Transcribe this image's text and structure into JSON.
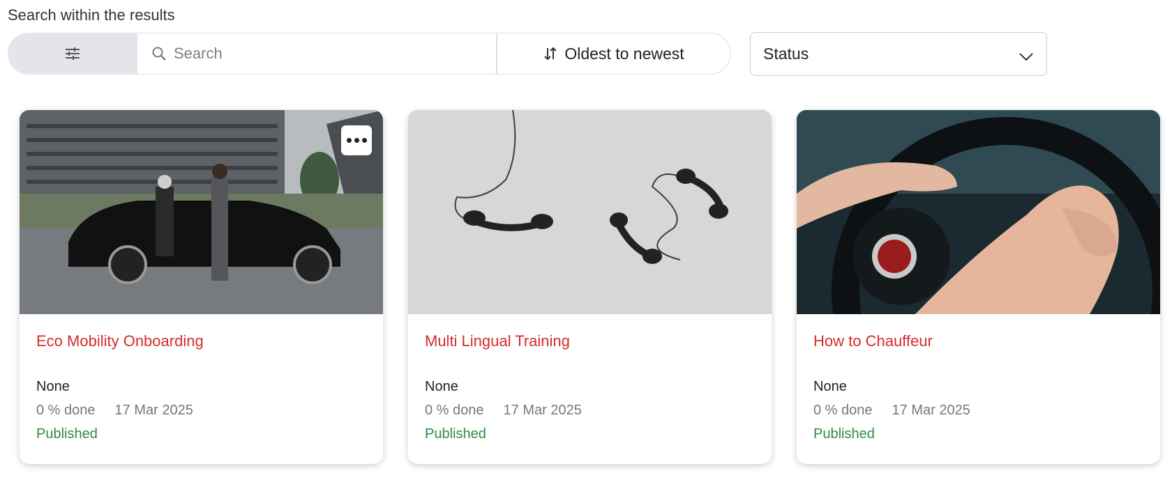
{
  "search_section": {
    "heading": "Search within the results",
    "search_placeholder": "Search",
    "sort_label": "Oldest to newest",
    "status_label": "Status"
  },
  "courses": [
    {
      "title": "Eco Mobility Onboarding",
      "owner": "None",
      "progress": "0 % done",
      "date": "17 Mar 2025",
      "status": "Published",
      "image": "chauffeur-car-photo"
    },
    {
      "title": "Multi Lingual Training",
      "owner": "None",
      "progress": "0 % done",
      "date": "17 Mar 2025",
      "status": "Published",
      "image": "telephone-handsets-photo"
    },
    {
      "title": "How to Chauffeur",
      "owner": "None",
      "progress": "0 % done",
      "date": "17 Mar 2025",
      "status": "Published",
      "image": "steering-wheel-photo"
    }
  ],
  "colors": {
    "title": "#d62b2b",
    "status": "#2e8b3a",
    "filter_bg": "#e3e5ea"
  }
}
